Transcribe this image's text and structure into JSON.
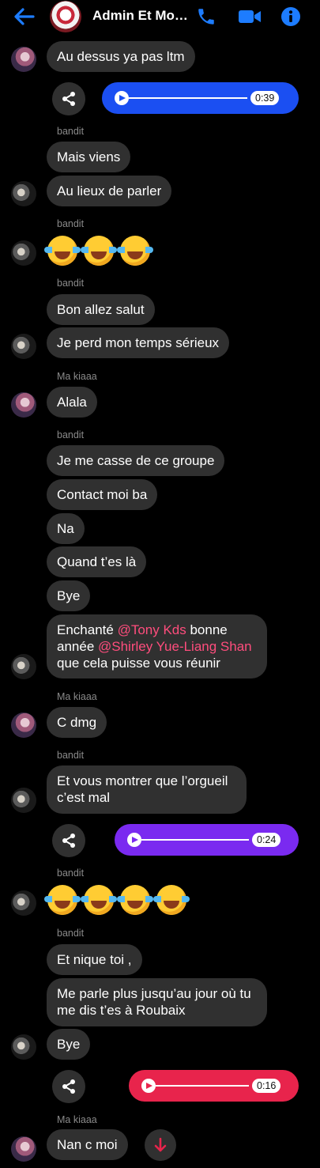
{
  "header": {
    "title": "Admin Et Mo…",
    "icons": [
      "back-arrow-icon",
      "phone-icon",
      "video-icon",
      "info-icon"
    ],
    "accent": "#1d7cff"
  },
  "senders": {
    "kiaaa": "Ma kiaaa",
    "bandit": "bandit"
  },
  "messages": {
    "m1": "Au dessus ya pas ltm",
    "m2": "Mais viens",
    "m3": "Au lieux de parler",
    "m4": "Bon allez salut",
    "m5": "Je perd mon temps sérieux",
    "m6": "Alala",
    "m7": "Je me casse de ce groupe",
    "m8": "Contact moi ba",
    "m9": "Na",
    "m10": "Quand t’es là",
    "m11": "Bye",
    "m12_a": "Enchanté ",
    "m12_mention1": "@Tony Kds",
    "m12_b": " bonne année ",
    "m12_mention2": "@Shirley Yue-Liang Shan",
    "m12_c": " que cela puisse vous réunir",
    "m13": "C dmg",
    "m14": "Et vous montrer que l’orgueil c’est mal",
    "m15": "Et nique toi ,",
    "m16": "Me parle plus jusqu’au jour où tu me dis t’es à Roubaix",
    "m17": "Bye",
    "m18": "Nan c moi"
  },
  "audio": {
    "a1": {
      "duration": "0:39",
      "color": "#1b4ff2"
    },
    "a2": {
      "duration": "0:24",
      "color": "#7a2af0"
    },
    "a3": {
      "duration": "0:16",
      "color": "#e8244c"
    }
  },
  "colors": {
    "bubble": "#303030",
    "mention": "#ff4d7d",
    "scroll_button_arrow": "#e8244c"
  }
}
